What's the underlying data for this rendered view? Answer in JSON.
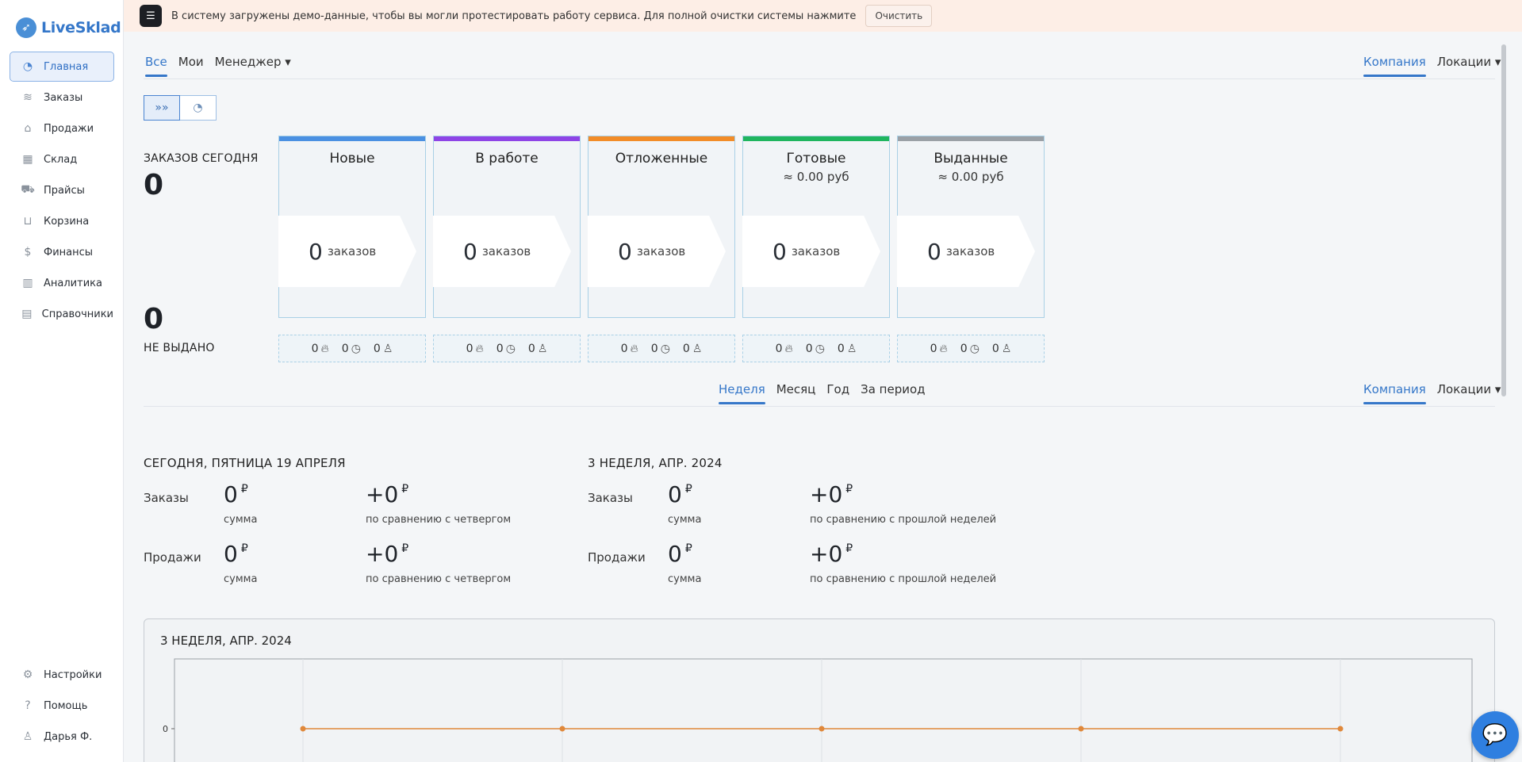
{
  "app": {
    "logo_text": "LiveSklad"
  },
  "sidebar": {
    "items": [
      {
        "label": "Главная",
        "icon": "pie-chart-icon",
        "glyph": "◔",
        "active": true
      },
      {
        "label": "Заказы",
        "icon": "layers-icon",
        "glyph": "≋"
      },
      {
        "label": "Продажи",
        "icon": "store-icon",
        "glyph": "⌂"
      },
      {
        "label": "Склад",
        "icon": "warehouse-icon",
        "glyph": "▦"
      },
      {
        "label": "Прайсы",
        "icon": "truck-icon",
        "glyph": "⛟"
      },
      {
        "label": "Корзина",
        "icon": "basket-icon",
        "glyph": "⊔"
      },
      {
        "label": "Финансы",
        "icon": "money-bag-icon",
        "glyph": "$"
      },
      {
        "label": "Аналитика",
        "icon": "bar-chart-icon",
        "glyph": "▥"
      },
      {
        "label": "Справочники",
        "icon": "document-icon",
        "glyph": "▤"
      }
    ],
    "bottom": [
      {
        "label": "Настройки",
        "icon": "gear-icon",
        "glyph": "⚙"
      },
      {
        "label": "Помощь",
        "icon": "help-icon",
        "glyph": "?"
      },
      {
        "label": "Дарья Ф.",
        "icon": "user-icon",
        "glyph": "♙"
      }
    ]
  },
  "banner": {
    "text": "В систему загружены демо-данные, чтобы вы могли протестировать работу сервиса. Для полной очистки системы нажмите",
    "button": "Очистить"
  },
  "filters": {
    "all": "Все",
    "mine": "Мои",
    "manager": "Менеджер ▾"
  },
  "scope": {
    "company": "Компания",
    "locations": "Локации ▾"
  },
  "orders_today": {
    "label": "ЗАКАЗОВ СЕГОДНЯ",
    "value": "0"
  },
  "not_issued": {
    "label": "НЕ ВЫДАНО",
    "value": "0"
  },
  "status_cards": [
    {
      "title": "Новые",
      "sub": "",
      "count": "0",
      "unit": "заказов",
      "color": "#4a90e2",
      "fire": "0",
      "clock": "0",
      "user": "0"
    },
    {
      "title": "В работе",
      "sub": "",
      "count": "0",
      "unit": "заказов",
      "color": "#8e44e6",
      "fire": "0",
      "clock": "0",
      "user": "0"
    },
    {
      "title": "Отложенные",
      "sub": "",
      "count": "0",
      "unit": "заказов",
      "color": "#f28c28",
      "fire": "0",
      "clock": "0",
      "user": "0"
    },
    {
      "title": "Готовые",
      "sub": "≈ 0.00 руб",
      "count": "0",
      "unit": "заказов",
      "color": "#1fb55f",
      "fire": "0",
      "clock": "0",
      "user": "0"
    },
    {
      "title": "Выданные",
      "sub": "≈ 0.00 руб",
      "count": "0",
      "unit": "заказов",
      "color": "#9aa0a6",
      "fire": "0",
      "clock": "0",
      "user": "0"
    }
  ],
  "period_tabs": {
    "week": "Неделя",
    "month": "Месяц",
    "year": "Год",
    "period": "За период"
  },
  "today_stats": {
    "title": "СЕГОДНЯ, ПЯТНИЦА 19 АПРЕЛЯ",
    "orders_label": "Заказы",
    "orders_value": "0",
    "orders_delta": "+0",
    "sales_label": "Продажи",
    "sales_value": "0",
    "sales_delta": "+0",
    "sum_caption": "сумма",
    "compare_caption": "по сравнению с четвергом",
    "currency": "₽"
  },
  "week_stats": {
    "title": "3 НЕДЕЛЯ, АПР. 2024",
    "orders_label": "Заказы",
    "orders_value": "0",
    "orders_delta": "+0",
    "sales_label": "Продажи",
    "sales_value": "0",
    "sales_delta": "+0",
    "sum_caption": "сумма",
    "compare_caption": "по сравнению с прошлой неделей",
    "currency": "₽"
  },
  "chart_data": {
    "type": "line",
    "title": "3 НЕДЕЛЯ, АПР. 2024",
    "y_ticks": [
      "0"
    ],
    "series": [
      {
        "values": [
          0,
          0,
          0,
          0,
          0
        ],
        "color": "#e0883a"
      }
    ],
    "grid": true
  },
  "chat": {
    "icon": "chat-bubble-icon"
  }
}
